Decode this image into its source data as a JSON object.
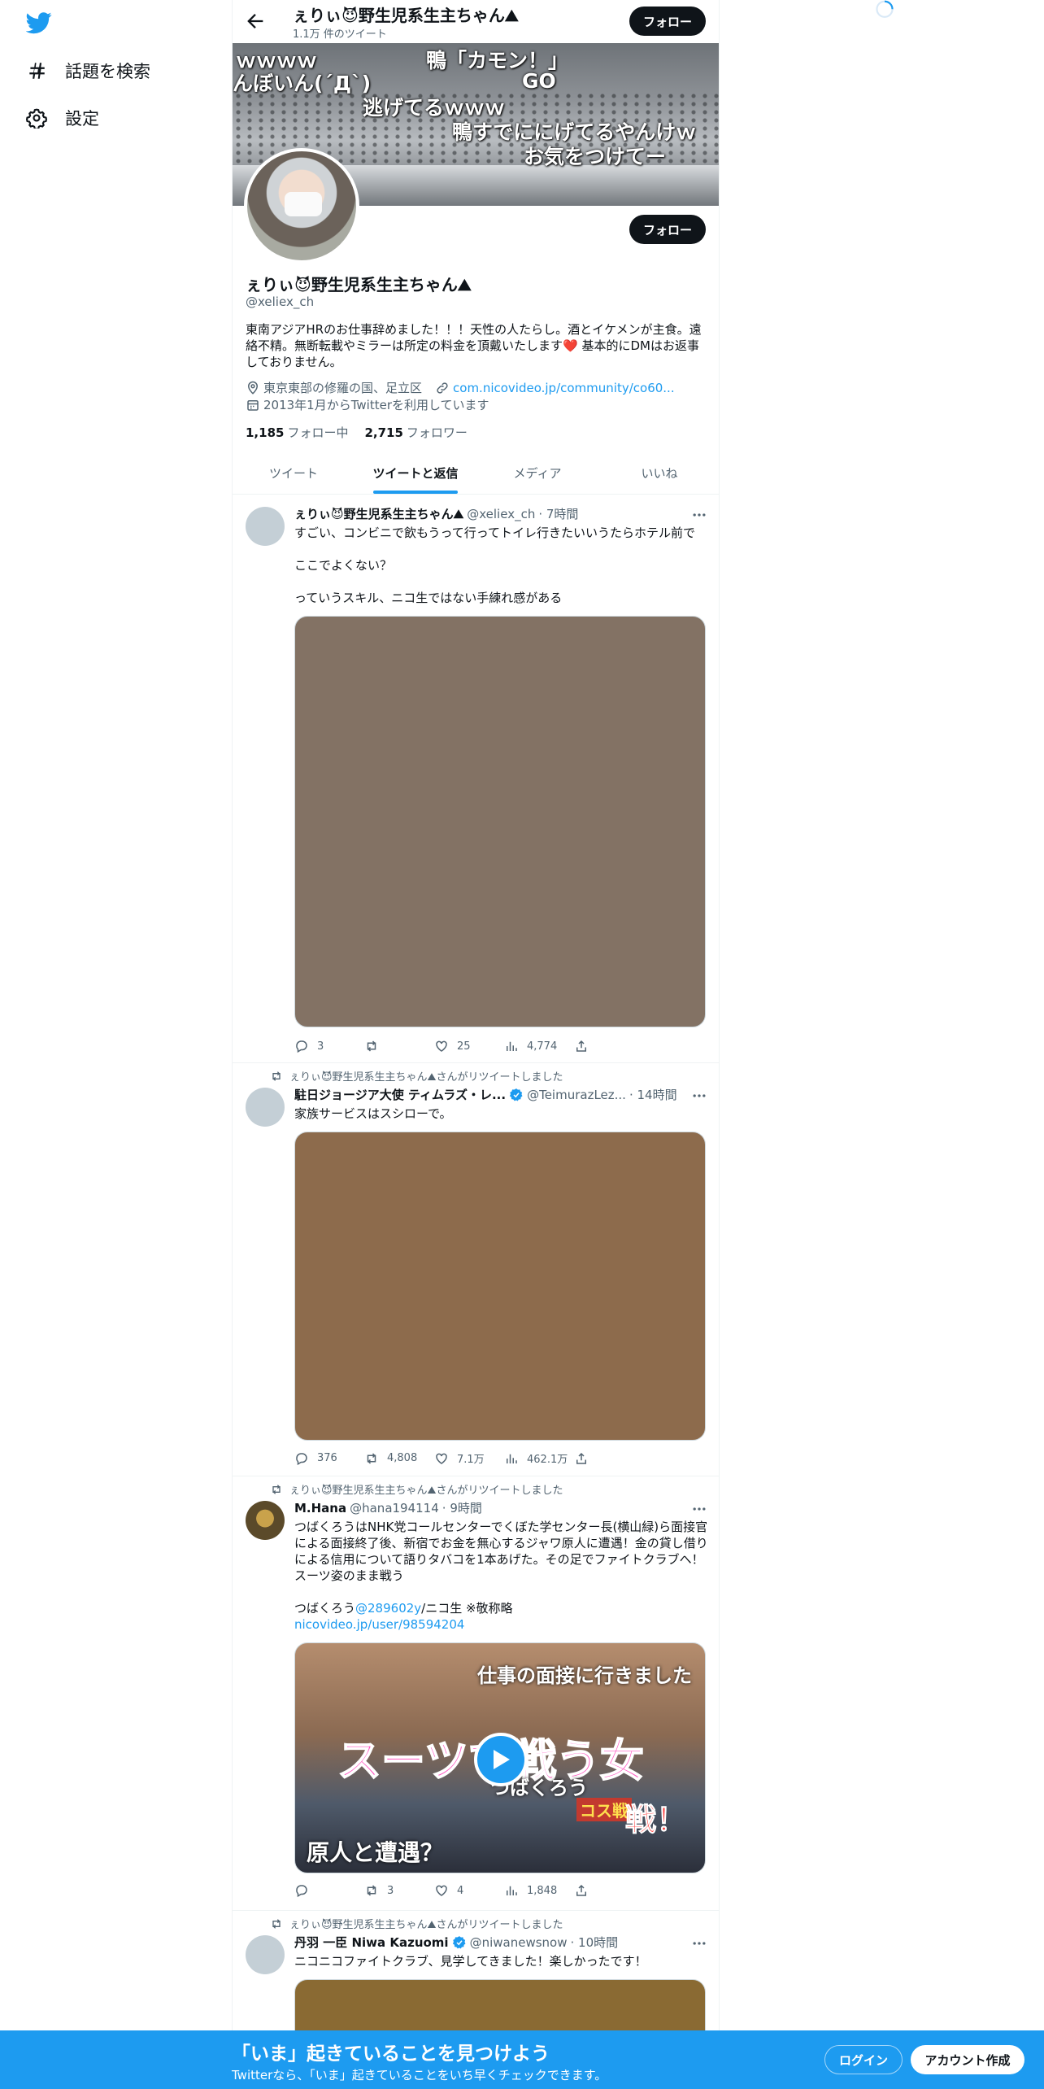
{
  "sidebar": {
    "explore_label": "話題を検索",
    "settings_label": "設定"
  },
  "header": {
    "title": "ぇりぃ😈野生児系生主ちゃん⛰",
    "tweet_count": "1.1万 件のツイート",
    "follow_label": "フォロー"
  },
  "banner": {
    "texts": [
      "ｗｗｗｗ",
      "鴨「カモン！」",
      "んぼいん(´Д`)",
      "GO",
      "逃げてるｗｗｗ",
      "鴨すでににげてるやんけｗ",
      "お気をつけてー"
    ]
  },
  "profile": {
    "follow_label": "フォロー",
    "name": "ぇりぃ😈野生児系生主ちゃん⛰",
    "handle": "@xeliex_ch",
    "bio": "東南アジアHRのお仕事辞めました！！！天性の人たらし。酒とイケメンが主食。遠絡不精。無断転載やミラーは所定の料金を頂戴いたします❤️ 基本的にDMはお返事しておりません。",
    "location": "東京東部の修羅の国、足立区",
    "url": "com.nicovideo.jp/community/co60...",
    "joined": "2013年1月からTwitterを利用しています",
    "following_count": "1,185",
    "following_label": "フォロー中",
    "followers_count": "2,715",
    "followers_label": "フォロワー"
  },
  "tabs": [
    {
      "label": "ツイート"
    },
    {
      "label": "ツイートと返信"
    },
    {
      "label": "メディア"
    },
    {
      "label": "いいね"
    }
  ],
  "tweets": [
    {
      "name": "ぇりぃ😈野生児系生主ちゃん⛰",
      "handle": "@xeliex_ch",
      "time": "· 7時間",
      "text_lines": [
        "すごい、コンビニで飲もうって行ってトイレ行きたいいうたらホテル前で",
        "ここでよくない？",
        "っていうスキル、ニコ生ではない手練れ感がある"
      ],
      "media_color": "#837264",
      "replies": "3",
      "retweets": "",
      "likes": "25",
      "views": "4,774"
    },
    {
      "retweet_by": "ぇりぃ😈野生児系生主ちゃん⛰さんがリツイートしました",
      "name": "駐日ジョージア大使 ティムラズ・レ...",
      "handle": "@TeimurazLez...",
      "time": "· 14時間",
      "text": "家族サービスはスシローで。",
      "media_color": "#8d6b4c",
      "replies": "376",
      "retweets": "4,808",
      "likes": "7.1万",
      "views": "462.1万"
    },
    {
      "retweet_by": "ぇりぃ😈野生児系生主ちゃん⛰さんがリツイートしました",
      "name": "M.Hana",
      "handle": "@hana194114",
      "time": "· 9時間",
      "text": "つばくろうはNHK党コールセンターでくぼた学センター長(横山緑)ら面接官による面接終了後、新宿でお金を無心するジャワ原人に遭遇！金の貸し借りによる信用について語りタバコを1本あげた。その足でファイトクラブへ！スーツ姿のまま戦う",
      "line2_prefix": "つばくろう",
      "line2_mention": "@289602y",
      "line2_suffix": "/ニコ生 ※敬称略",
      "line3_link": "nicovideo.jp/user/98594204",
      "video_texts": [
        "仕事の面接に行きました",
        "スーツで戦う女",
        "つばくろう",
        "原人と遭遇？",
        "コス戦",
        "戦！"
      ],
      "replies": "",
      "retweets": "3",
      "likes": "4",
      "views": "1,848"
    },
    {
      "retweet_by": "ぇりぃ😈野生児系生主ちゃん⛰さんがリツイートしました",
      "name": "丹羽 一臣 Niwa Kazuomi",
      "handle": "@niwanewsnow",
      "time": "· 10時間",
      "text": "ニコニコファイトクラブ、見学してきました！楽しかったです！",
      "media_color": "#8a6a33"
    }
  ],
  "bottom_bar": {
    "title": "「いま」起きていることを見つけよう",
    "subtitle": "Twitterなら、「いま」起きていることをいち早くチェックできます。",
    "login_label": "ログイン",
    "signup_label": "アカウント作成"
  }
}
